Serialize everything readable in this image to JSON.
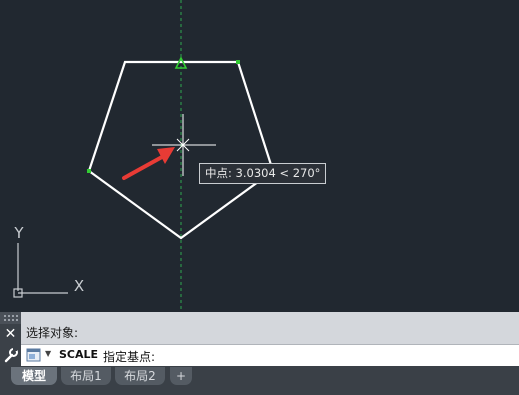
{
  "tooltip": {
    "label": "中点",
    "separator": ":",
    "distance": "3.0304",
    "angle_symbol": "<",
    "angle": "270°"
  },
  "ucs": {
    "y_label": "Y",
    "x_label": "X"
  },
  "command_line": {
    "history": "选择对象:",
    "command": "SCALE",
    "prompt": "指定基点:"
  },
  "tabs": [
    {
      "label": "模型",
      "active": true
    },
    {
      "label": "布局1",
      "active": false
    },
    {
      "label": "布局2",
      "active": false
    },
    {
      "label": "+",
      "active": false
    }
  ],
  "icons": {
    "close": "close-icon",
    "customize": "wrench-icon",
    "recent_commands": "command-history-icon"
  },
  "colors": {
    "background": "#212830",
    "polygon": "#ffffff",
    "snap_marker": "#33cc33",
    "tracking_line": "#2fa84f",
    "arrow": "#e83b35"
  }
}
